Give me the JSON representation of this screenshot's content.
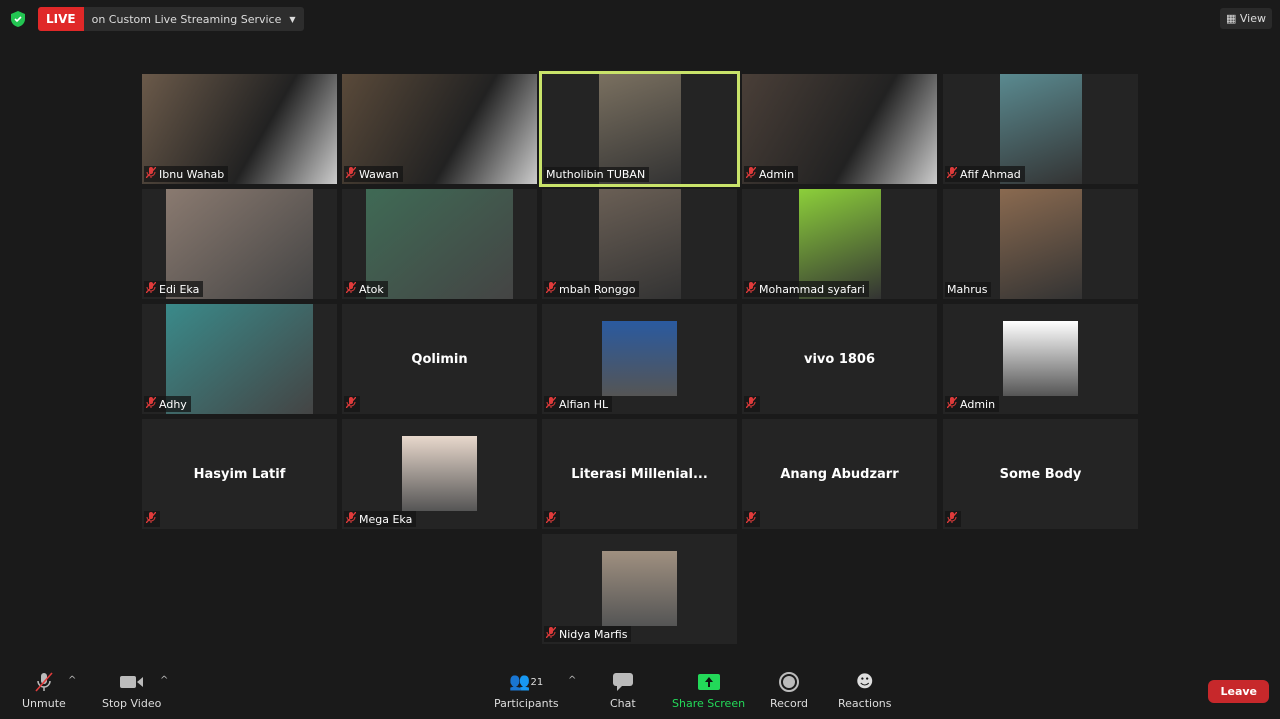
{
  "top": {
    "live": "LIVE",
    "service": "on Custom Live Streaming Service",
    "view": "View",
    "shield_color": "#23c552"
  },
  "tiles": [
    {
      "name": "Ibnu Wahab",
      "kind": "video",
      "muted": true,
      "c": "#6b5a4a"
    },
    {
      "name": "Wawan",
      "kind": "video",
      "muted": true,
      "c": "#5a4a3a"
    },
    {
      "name": "Mutholibin TUBAN",
      "kind": "portrait",
      "muted": false,
      "active": true,
      "c": "#7a7060"
    },
    {
      "name": "Admin",
      "kind": "video",
      "muted": true,
      "c": "#4a3f38"
    },
    {
      "name": "Afif Ahmad",
      "kind": "portrait",
      "muted": true,
      "c": "#5a8a90"
    },
    {
      "name": "Edi Eka",
      "kind": "wide",
      "muted": true,
      "c": "#8a7a70"
    },
    {
      "name": "Atok",
      "kind": "wide",
      "muted": true,
      "c": "#3f6a55"
    },
    {
      "name": "mbah Ronggo",
      "kind": "portrait",
      "muted": true,
      "c": "#6a5f55"
    },
    {
      "name": "Mohammad syafari",
      "kind": "portrait",
      "muted": true,
      "c": "#8ccf3a"
    },
    {
      "name": "Mahrus",
      "kind": "portrait",
      "muted": false,
      "c": "#8a6a50"
    },
    {
      "name": "Adhy",
      "kind": "wide",
      "muted": true,
      "c": "#3a8a8a"
    },
    {
      "name": "Qolimin",
      "kind": "name",
      "muted": true
    },
    {
      "name": "Alfian HL",
      "kind": "avatar",
      "muted": true,
      "c": "#2a5aa0"
    },
    {
      "name": "vivo 1806",
      "kind": "name",
      "muted": true
    },
    {
      "name": "Admin",
      "kind": "avatar",
      "muted": true,
      "c": "#ffffff"
    },
    {
      "name": "Hasyim Latif",
      "kind": "name",
      "muted": true
    },
    {
      "name": "Mega Eka",
      "kind": "avatar",
      "muted": true,
      "c": "#e8d8cc"
    },
    {
      "name": "Literasi  Millenial...",
      "kind": "name",
      "muted": true
    },
    {
      "name": "Anang Abudzarr",
      "kind": "name",
      "muted": true
    },
    {
      "name": "Some Body",
      "kind": "name",
      "muted": true
    },
    {
      "name": "Nidya Marfis",
      "kind": "avatar",
      "muted": true,
      "c": "#a09080"
    }
  ],
  "toolbar": {
    "unmute": "Unmute",
    "stop_video": "Stop Video",
    "participants": "Participants",
    "participant_count": "21",
    "chat": "Chat",
    "share": "Share Screen",
    "record": "Record",
    "reactions": "Reactions",
    "leave": "Leave",
    "share_color": "#23d959",
    "leave_color": "#c7282b"
  }
}
